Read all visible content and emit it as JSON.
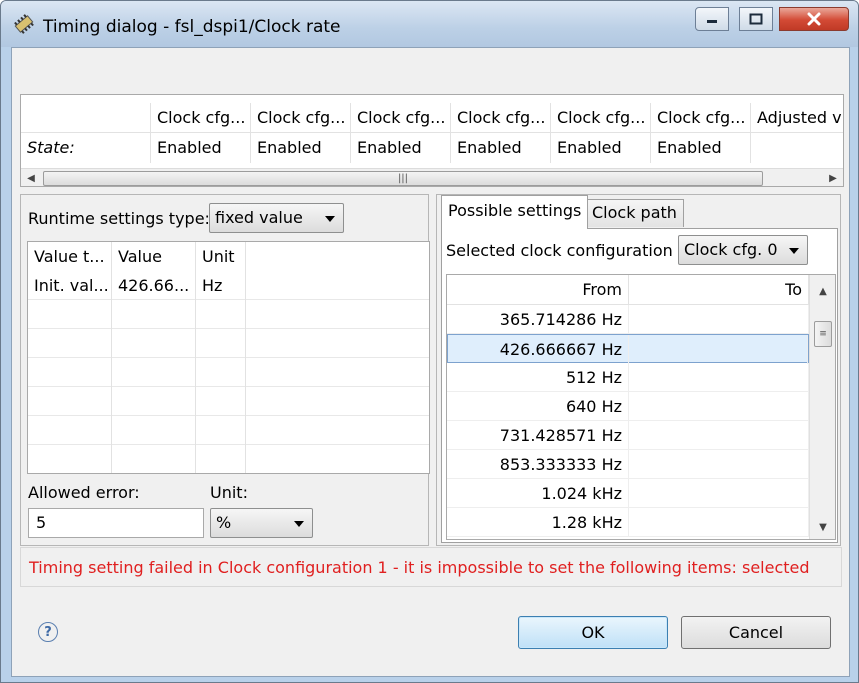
{
  "window": {
    "title": "Timing dialog - fsl_dspi1/Clock rate"
  },
  "top_grid": {
    "headers": [
      "",
      "Clock cfg...",
      "Clock cfg...",
      "Clock cfg...",
      "Clock cfg...",
      "Clock cfg...",
      "Clock cfg...",
      "Adjusted v"
    ],
    "state_label": "State:",
    "state_values": [
      "Enabled",
      "Enabled",
      "Enabled",
      "Enabled",
      "Enabled",
      "Enabled",
      ""
    ]
  },
  "runtime": {
    "label": "Runtime settings type:",
    "value": "fixed value"
  },
  "value_table": {
    "headers": [
      "Value t...",
      "Value",
      "Unit"
    ],
    "rows": [
      [
        "Init. val...",
        "426.66...",
        "Hz"
      ]
    ]
  },
  "allowed_error": {
    "label": "Allowed error:",
    "value": "5",
    "unit_label": "Unit:",
    "unit_value": "%"
  },
  "tabs": {
    "possible_settings": "Possible settings",
    "clock_path": "Clock path"
  },
  "selected_config": {
    "label": "Selected clock configuration",
    "value": "Clock cfg. 0"
  },
  "range_table": {
    "headers": [
      "From",
      "To"
    ],
    "rows": [
      [
        "365.714286 Hz",
        ""
      ],
      [
        "426.666667 Hz",
        ""
      ],
      [
        "512 Hz",
        ""
      ],
      [
        "640 Hz",
        ""
      ],
      [
        "731.428571 Hz",
        ""
      ],
      [
        "853.333333 Hz",
        ""
      ],
      [
        "1.024 kHz",
        ""
      ],
      [
        "1.28 kHz",
        ""
      ]
    ],
    "selected_index": 1
  },
  "error_message": "Timing setting failed in Clock configuration 1 - it is impossible to set the following items: selected",
  "buttons": {
    "help": "?",
    "ok": "OK",
    "cancel": "Cancel"
  },
  "colors": {
    "error_text": "#e02020",
    "selection": "#dfeefc"
  }
}
